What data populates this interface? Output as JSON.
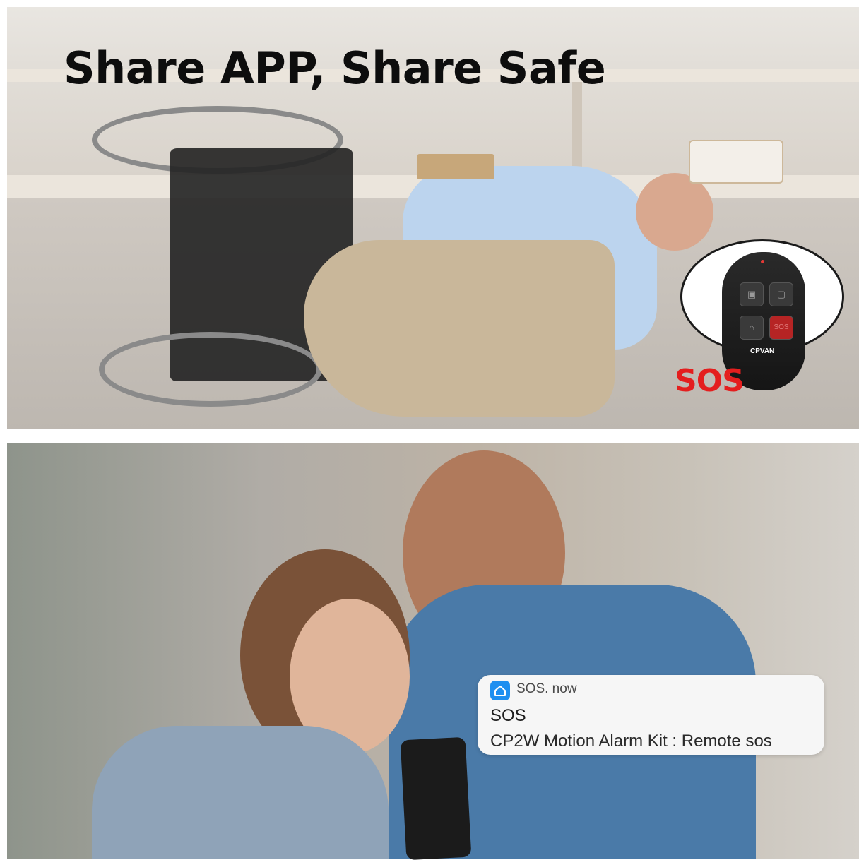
{
  "headline": "Share APP, Share Safe",
  "remote": {
    "sos_button_label": "SOS",
    "brand": "CPVAN",
    "callout": "SOS"
  },
  "notification": {
    "app": "SOS. now",
    "title": "SOS",
    "body": "CP2W Motion Alarm Kit : Remote sos"
  },
  "colors": {
    "headline": "#0d0d0d",
    "sos_red": "#e41e1e",
    "app_icon": "#1e8ff0"
  },
  "icons": [
    "home-app-icon",
    "lock-icon",
    "unlock-icon",
    "home-icon"
  ]
}
